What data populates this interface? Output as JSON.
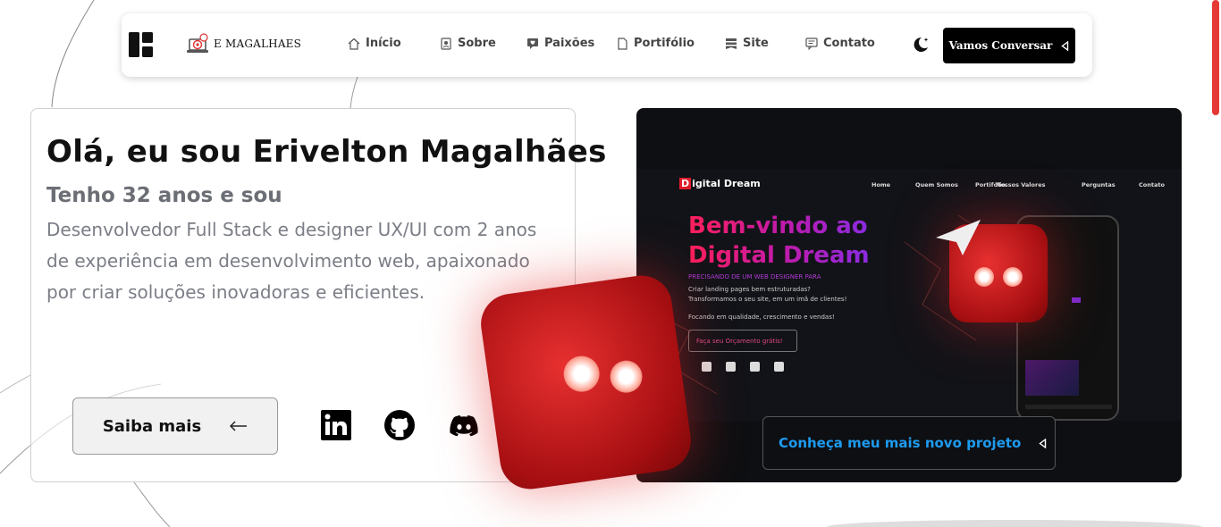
{
  "nav": {
    "brand": "E MAGALHAES",
    "items": [
      {
        "label": "Início",
        "icon": "home-icon"
      },
      {
        "label": "Sobre",
        "icon": "user-badge-icon"
      },
      {
        "label": "Paixões",
        "icon": "heart-chat-icon"
      },
      {
        "label": "Portifólio",
        "icon": "document-icon"
      },
      {
        "label": "Site",
        "icon": "layers-icon"
      },
      {
        "label": "Contato",
        "icon": "message-icon"
      }
    ],
    "theme_icon": "moon-icon",
    "cta_label": "Vamos Conversar"
  },
  "hero": {
    "title": "Olá, eu sou Erivelton Magalhães",
    "subtitle": "Tenho 32 anos e sou",
    "description": "Desenvolvedor Full Stack e designer UX/UI com 2 anos de experiência em desenvolvimento web, apaixonado por criar soluções inovadoras e eficientes.",
    "button_label": "Saiba mais",
    "socials": [
      "linkedin-icon",
      "github-icon",
      "discord-icon",
      "whatsapp-icon"
    ]
  },
  "project": {
    "brand_d": "D",
    "brand_rest": "igital Dream",
    "nav": [
      "Home",
      "Quem Somos",
      "Portifólio",
      "Nossos Valores",
      "Perguntas",
      "Contato"
    ],
    "title_line1": "Bem-vindo ao",
    "title_line2": "Digital Dream",
    "tagline": "PRECISANDO DE UM WEB DESIGNER PARA",
    "line1": "Criar landing pages bem estruturadas?",
    "line2": "Transformamos o seu site, em um imã de clientes!",
    "line3": "Focando em qualidade, crescimento e vendas!",
    "cta": "Faça seu Orçamento grátis!",
    "button_label": "Conheça meu mais novo projeto"
  },
  "colors": {
    "accent_red": "#e11b2a",
    "link_blue": "#1d9bf0",
    "scrollbar": "#e53935"
  }
}
